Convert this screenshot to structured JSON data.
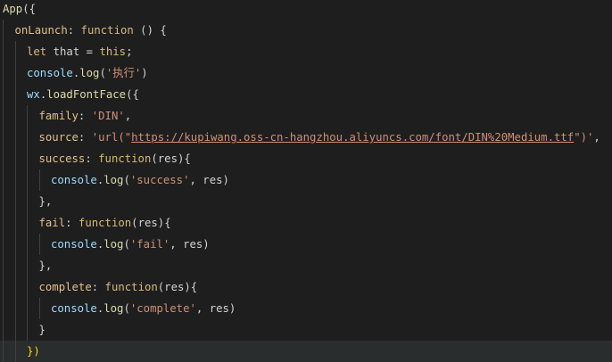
{
  "editor": {
    "lines": [
      {
        "indent": 0,
        "tokens": [
          [
            "fn",
            "App"
          ],
          [
            "punc",
            "({"
          ]
        ]
      },
      {
        "indent": 1,
        "tokens": [
          [
            "prop",
            "onLaunch"
          ],
          [
            "punc",
            ": "
          ],
          [
            "kw2",
            "function"
          ],
          [
            "punc",
            " () {"
          ]
        ]
      },
      {
        "indent": 2,
        "tokens": [
          [
            "kw2",
            "let"
          ],
          [
            "punc",
            " that = "
          ],
          [
            "kw2",
            "this"
          ],
          [
            "punc",
            ";"
          ]
        ]
      },
      {
        "indent": 2,
        "tokens": [
          [
            "obj",
            "console"
          ],
          [
            "punc",
            "."
          ],
          [
            "fn",
            "log"
          ],
          [
            "punc",
            "("
          ],
          [
            "str",
            "'执行'"
          ],
          [
            "punc",
            ")"
          ]
        ]
      },
      {
        "indent": 2,
        "tokens": [
          [
            "obj",
            "wx"
          ],
          [
            "punc",
            "."
          ],
          [
            "fn",
            "loadFontFace"
          ],
          [
            "punc",
            "({"
          ]
        ]
      },
      {
        "indent": 3,
        "tokens": [
          [
            "prop",
            "family"
          ],
          [
            "punc",
            ": "
          ],
          [
            "str",
            "'DIN'"
          ],
          [
            "punc",
            ","
          ]
        ]
      },
      {
        "indent": 3,
        "tokens": [
          [
            "prop",
            "source"
          ],
          [
            "punc",
            ": "
          ],
          [
            "str",
            "'url(\""
          ],
          [
            "url",
            "https://kupiwang.oss-cn-hangzhou.aliyuncs.com/font/DIN%20Medium.ttf"
          ],
          [
            "str",
            "\")'"
          ],
          [
            "punc",
            ","
          ]
        ]
      },
      {
        "indent": 3,
        "tokens": [
          [
            "prop",
            "success"
          ],
          [
            "punc",
            ": "
          ],
          [
            "kw2",
            "function"
          ],
          [
            "punc",
            "(res){"
          ]
        ]
      },
      {
        "indent": 4,
        "tokens": [
          [
            "obj",
            "console"
          ],
          [
            "punc",
            "."
          ],
          [
            "fn",
            "log"
          ],
          [
            "punc",
            "("
          ],
          [
            "str",
            "'success'"
          ],
          [
            "punc",
            ", res)"
          ]
        ]
      },
      {
        "indent": 3,
        "tokens": [
          [
            "punc",
            "},"
          ]
        ]
      },
      {
        "indent": 3,
        "tokens": [
          [
            "prop",
            "fail"
          ],
          [
            "punc",
            ": "
          ],
          [
            "kw2",
            "function"
          ],
          [
            "punc",
            "(res){"
          ]
        ]
      },
      {
        "indent": 4,
        "tokens": [
          [
            "obj",
            "console"
          ],
          [
            "punc",
            "."
          ],
          [
            "fn",
            "log"
          ],
          [
            "punc",
            "("
          ],
          [
            "str",
            "'fail'"
          ],
          [
            "punc",
            ", res)"
          ]
        ]
      },
      {
        "indent": 3,
        "tokens": [
          [
            "punc",
            "},"
          ]
        ]
      },
      {
        "indent": 3,
        "tokens": [
          [
            "prop",
            "complete"
          ],
          [
            "punc",
            ": "
          ],
          [
            "kw2",
            "function"
          ],
          [
            "punc",
            "(res){"
          ]
        ]
      },
      {
        "indent": 4,
        "tokens": [
          [
            "obj",
            "console"
          ],
          [
            "punc",
            "."
          ],
          [
            "fn",
            "log"
          ],
          [
            "punc",
            "("
          ],
          [
            "str",
            "'complete'"
          ],
          [
            "punc",
            ", res)"
          ]
        ]
      },
      {
        "indent": 3,
        "tokens": [
          [
            "punc",
            "}"
          ]
        ]
      },
      {
        "indent": 2,
        "current": true,
        "tokens": [
          [
            "yellow",
            "})"
          ]
        ]
      }
    ]
  }
}
